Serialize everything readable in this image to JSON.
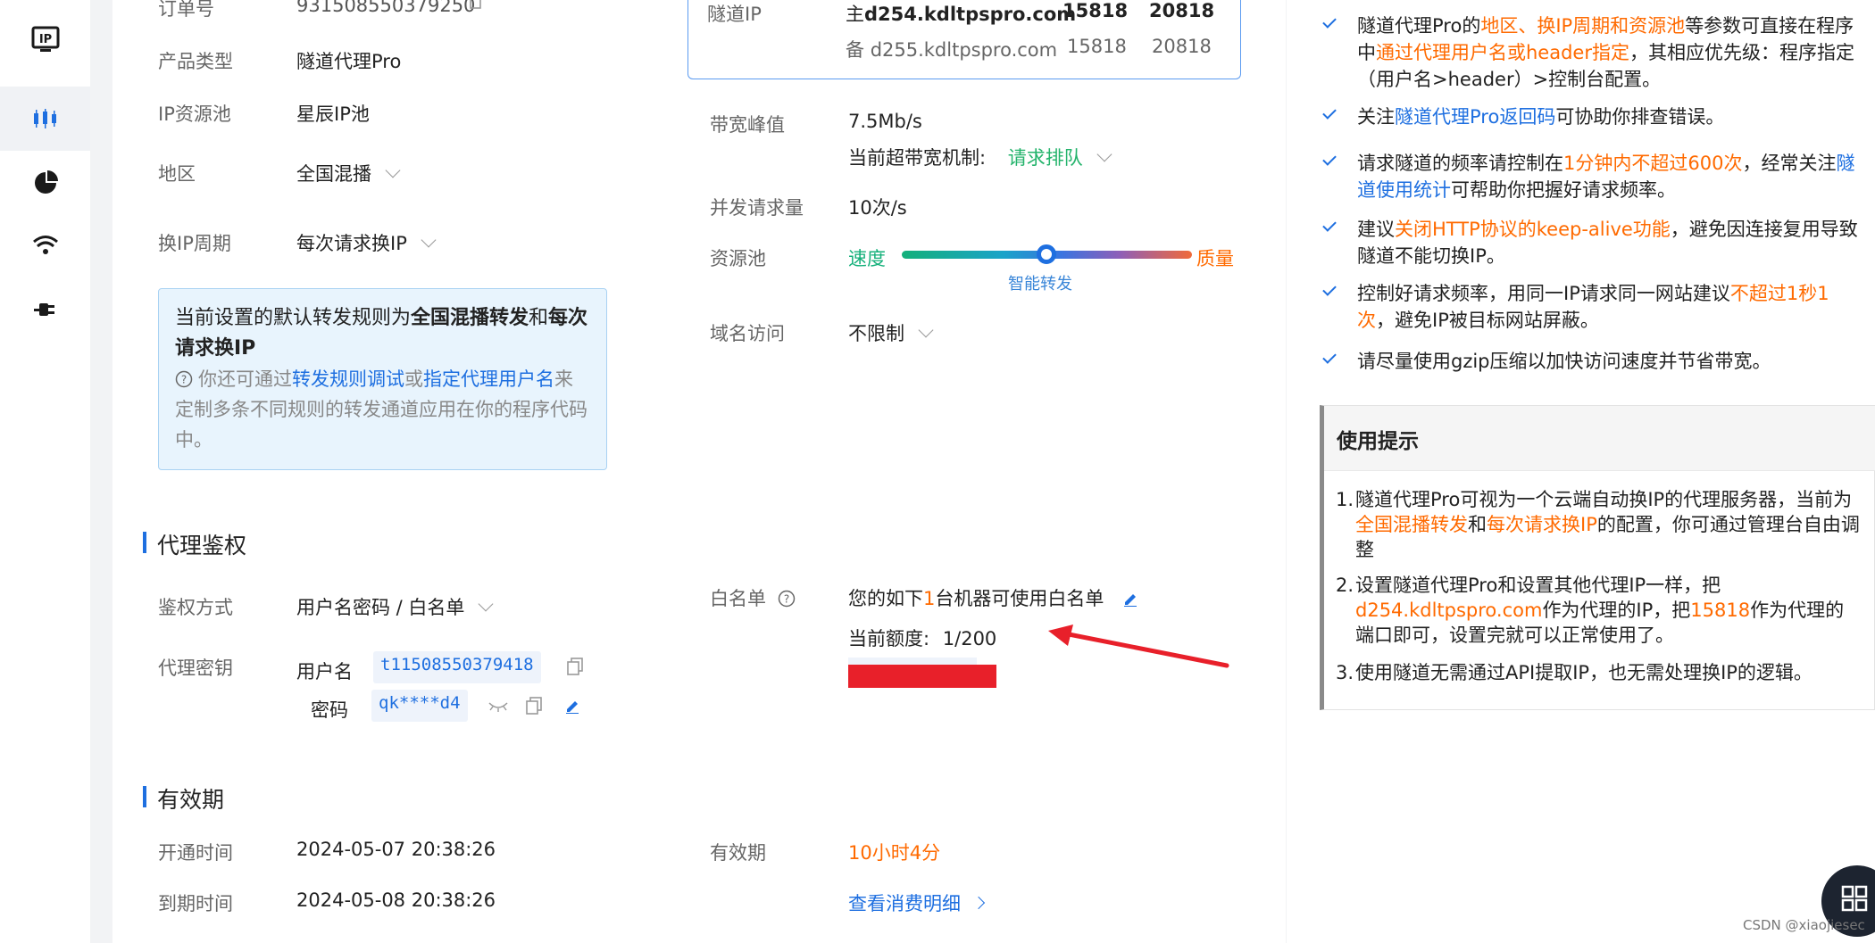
{
  "rail": {
    "items": [
      {
        "icon": "ip-icon"
      },
      {
        "icon": "candlestick-icon",
        "active": true
      },
      {
        "icon": "pie-chart-icon"
      },
      {
        "icon": "wifi-icon"
      },
      {
        "icon": "plug-icon"
      }
    ]
  },
  "order": {
    "label": "订单号",
    "value": "931508550379250"
  },
  "product": {
    "type_label": "产品类型",
    "type_value": "隧道代理Pro",
    "pool_label": "IP资源池",
    "pool_value": "星辰IP池",
    "region_label": "地区",
    "region_value": "全国混播",
    "cycle_label": "换IP周期",
    "cycle_value": "每次请求换IP"
  },
  "infobox": {
    "line1_prefix": "当前设置的默认转发规则为",
    "line1_rule": "全国混播转发",
    "line1_and": "和",
    "line1_cycle": "每次请求换IP",
    "hint_prefix": "你还可通过",
    "hint_link1": "转发规则调试",
    "hint_or": "或",
    "hint_link2": "指定代理用户名",
    "hint_suffix": "来定制多条不同规则的转发通道应用在你的程序代码中。"
  },
  "tunnel": {
    "label": "隧道IP",
    "main_prefix": "主",
    "main_host": "d254.kdltpspro.com",
    "main_port1": "15818",
    "main_port2": "20818",
    "backup_prefix": "备",
    "backup_host": "d255.kdltpspro.com",
    "backup_port1": "15818",
    "backup_port2": "20818"
  },
  "bandwidth": {
    "label": "带宽峰值",
    "value": "7.5Mb/s",
    "over_label": "当前超带宽机制:",
    "over_value": "请求排队"
  },
  "concurrency": {
    "label": "并发请求量",
    "value": "10次/s"
  },
  "pool_slider": {
    "label": "资源池",
    "left": "速度",
    "right": "质量",
    "center": "智能转发",
    "position": 0.5
  },
  "domain": {
    "label": "域名访问",
    "value": "不限制"
  },
  "auth_section": {
    "title": "代理鉴权",
    "method_label": "鉴权方式",
    "method_value": "用户名密码 / 白名单",
    "key_label": "代理密钥",
    "user_label": "用户名",
    "user_value": "t11508550379418",
    "pass_label": "密码",
    "pass_value": "qk****d4"
  },
  "whitelist": {
    "label": "白名单",
    "text_prefix": "您的如下",
    "count": "1",
    "text_suffix": "台机器可使用白名单",
    "quota_label": "当前额度:",
    "quota_value": "1/200"
  },
  "validity_section": {
    "title": "有效期",
    "start_label": "开通时间",
    "start_value": "2024-05-07 20:38:26",
    "end_label": "到期时间",
    "end_value": "2024-05-08 20:38:26",
    "remain_label": "有效期",
    "remain_value": "10小时4分",
    "detail_link": "查看消费明细"
  },
  "side_checks": [
    {
      "parts": [
        [
          "隧道代理Pro的",
          ""
        ],
        [
          "地区、换IP周期和资源池",
          "orange"
        ],
        [
          "等参数可直接在程序中",
          ""
        ],
        [
          "通过代理用户名或header指定",
          "orange"
        ],
        [
          "，其相应优先级：程序指定（用户名>header）>控制台配置。",
          ""
        ]
      ]
    },
    {
      "parts": [
        [
          "关注",
          ""
        ],
        [
          "隧道代理Pro返回码",
          "blue"
        ],
        [
          "可协助你排查错误。",
          ""
        ]
      ]
    },
    {
      "parts": [
        [
          "请求隧道的频率请控制在",
          ""
        ],
        [
          "1分钟内不超过600次",
          "orange"
        ],
        [
          "，经常关注",
          ""
        ],
        [
          "隧道使用统计",
          "blue"
        ],
        [
          "可帮助你把握好请求频率。",
          ""
        ]
      ]
    },
    {
      "parts": [
        [
          "建议",
          ""
        ],
        [
          "关闭HTTP协议的keep-alive功能",
          "orange"
        ],
        [
          "，避免因连接复用导致隧道不能切换IP。",
          ""
        ]
      ]
    },
    {
      "parts": [
        [
          "控制好请求频率，用同一IP请求同一网站建议",
          ""
        ],
        [
          "不超过1秒1次",
          "orange"
        ],
        [
          "，避免IP被目标网站屏蔽。",
          ""
        ]
      ]
    },
    {
      "parts": [
        [
          "请尽量使用gzip压缩以加快访问速度并节省带宽。",
          ""
        ]
      ]
    }
  ],
  "tips": {
    "title": "使用提示",
    "items": [
      {
        "num": "1.",
        "parts": [
          [
            "隧道代理Pro可视为一个云端自动换IP的代理服务器，当前为",
            ""
          ],
          [
            "全国混播转发",
            "orange"
          ],
          [
            "和",
            ""
          ],
          [
            "每次请求换IP",
            "orange"
          ],
          [
            "的配置，你可通过管理台自由调整",
            ""
          ]
        ]
      },
      {
        "num": "2.",
        "parts": [
          [
            "设置隧道代理Pro和设置其他代理IP一样，把",
            ""
          ],
          [
            "d254.kdltpspro.com",
            "orange"
          ],
          [
            "作为代理的IP，把",
            ""
          ],
          [
            "15818",
            "orange"
          ],
          [
            "作为代理的端口即可，设置完就可以正常使用了。",
            ""
          ]
        ]
      },
      {
        "num": "3.",
        "parts": [
          [
            "使用隧道无需通过API提取IP，也无需处理换IP的逻辑。",
            ""
          ]
        ]
      }
    ]
  },
  "watermark": "CSDN @xiaojiesec",
  "colors": {
    "accent": "#1e6fe0",
    "orange": "#ff6a00",
    "green": "#23b36b",
    "redact": "#e8202a"
  }
}
